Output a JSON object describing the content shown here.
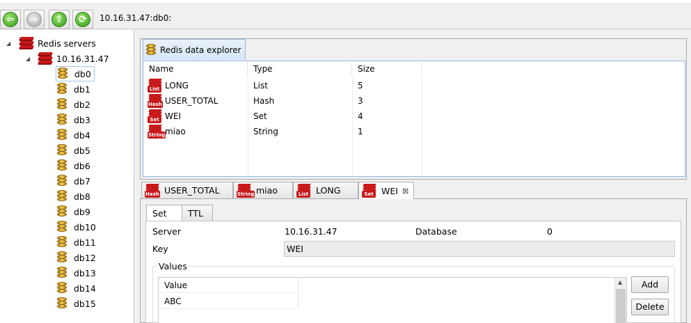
{
  "toolbar": {
    "buttons": [
      {
        "icon": "back-arrow-icon",
        "glyph": "⇦",
        "enabled": true
      },
      {
        "icon": "forward-arrow-icon",
        "glyph": "⇨",
        "enabled": false
      },
      {
        "icon": "up-arrow-icon",
        "glyph": "⇧",
        "enabled": true
      },
      {
        "icon": "refresh-icon",
        "glyph": "⟳",
        "enabled": true
      }
    ],
    "path": "10.16.31.47:db0:"
  },
  "tree": {
    "root_label": "Redis servers",
    "server_label": "10.16.31.47",
    "databases": [
      "db0",
      "db1",
      "db2",
      "db3",
      "db4",
      "db5",
      "db6",
      "db7",
      "db8",
      "db9",
      "db10",
      "db11",
      "db12",
      "db13",
      "db14",
      "db15"
    ],
    "selected": "db0"
  },
  "explorer": {
    "tab_label": "Redis data explorer",
    "columns": [
      "Name",
      "Type",
      "Size"
    ],
    "rows": [
      {
        "name": "LONG",
        "type": "List",
        "size": "5",
        "tag": "List"
      },
      {
        "name": "USER_TOTAL",
        "type": "Hash",
        "size": "3",
        "tag": "Hash"
      },
      {
        "name": "WEI",
        "type": "Set",
        "size": "4",
        "tag": "Set"
      },
      {
        "name": "miao",
        "type": "String",
        "size": "1",
        "tag": "String"
      }
    ]
  },
  "editor_tabs": [
    {
      "label": "USER_TOTAL",
      "tag": "Hash",
      "active": false
    },
    {
      "label": "miao",
      "tag": "String",
      "active": false
    },
    {
      "label": "LONG",
      "tag": "List",
      "active": false
    },
    {
      "label": "WEI",
      "tag": "Set",
      "active": true,
      "close": "⊠"
    }
  ],
  "detail": {
    "sub_tabs": [
      "Set",
      "TTL"
    ],
    "server_label": "Server",
    "server_value": "10.16.31.47",
    "database_label": "Database",
    "database_value": "0",
    "key_label": "Key",
    "key_value": "WEI",
    "values_title": "Values",
    "values_column": "Value",
    "values": [
      "ABC"
    ],
    "add_label": "Add",
    "delete_label": "Delete"
  }
}
